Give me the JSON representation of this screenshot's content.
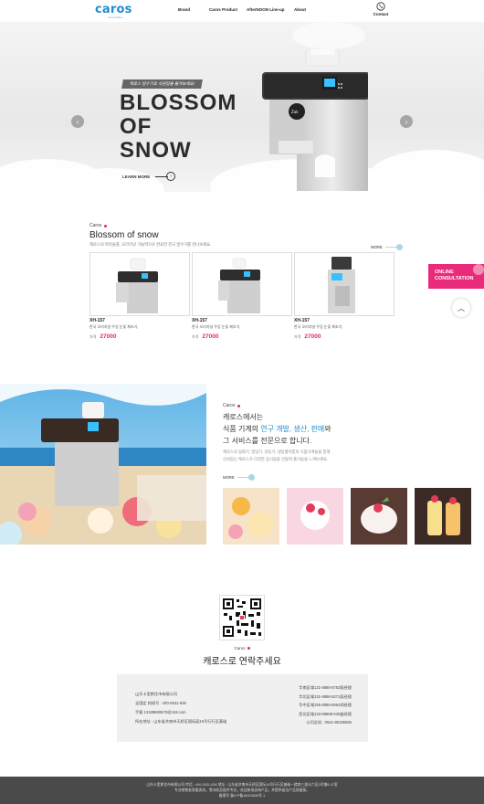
{
  "header": {
    "logo_text": "caros",
    "logo_sub": "Snow Maker",
    "nav": [
      "Brand",
      "Caros Product",
      "AfterNOON Line-up",
      "About"
    ],
    "contact_label": "Contact"
  },
  "hero": {
    "tag": "캐로스 빙수기로 식원함을 즐겨보세요!",
    "title_lines": [
      "BLOSSOM",
      "OF",
      "SNOW"
    ],
    "learn_more": "LEARN MORE",
    "prev_glyph": "‹",
    "next_glyph": "›"
  },
  "products": {
    "label": "Caros",
    "title": "Blossom of snow",
    "desc": "캐로스의 파라솔를, 오라지냥 기술력으로 완료한 한국 빙수기를 만나보세요.",
    "more": "MORE",
    "items": [
      {
        "name": "XH-157",
        "desc": "한국 오리지널 우잉 눈꽃 제조기,",
        "price_label": "가격",
        "price": "27000"
      },
      {
        "name": "XH-157",
        "desc": "한국 오리지널 우잉 눈꽃 제조기,",
        "price_label": "가격",
        "price": "27000"
      },
      {
        "name": "XH-157",
        "desc": "한국 오리지널 우잉 눈꽃 제조기,",
        "price_label": "가격",
        "price": "27000"
      }
    ]
  },
  "float": {
    "consult_line1": "ONLINE",
    "consult_line2": "CONSULTATION",
    "top_glyph": "︿"
  },
  "about": {
    "label": "Caros",
    "line1": "캐로스에서는",
    "line2_pre": "식품 기계의 ",
    "line2_hl": "연구 개발, 생산, 판매",
    "line2_post": "와",
    "line3": "그 서비스를 전문으로 합니다.",
    "desc1": "캐로스의 설화기, 얼빙기, 냉동기, 냉동혈어통의 식품기계들을 통해",
    "desc2": "신뢰있는 캐로스가 다양한 음식들을 만들며 즐거움을 느껴보세요.",
    "more": "MORE"
  },
  "contact": {
    "label": "Caros",
    "title": "캐로스로 연락주세요",
    "left_lines": [
      "山乐卡里斯住市有限公司",
      "全国定 热线号 : 400-0531-636",
      "手客 13188880570@163.com",
      "所在地址 : 山东省济南市天桥区国际园15号行行区基础"
    ],
    "right_lines": [
      "华南区域131-8888-5753段经理",
      "华北区域131-8888-5271段经理",
      "华中区域155-8888-6954郑经理",
      "西北区域133-88888-639盛经理",
      "公司总机 : 0531-89195555"
    ]
  },
  "footer": {
    "line1": "山东卡里斯住市有限公司 传话 : 400-0531-636 地址 : 山东省济南市天桥区国际15号行行区基础一楼南三部分六区3号铺6-37室",
    "line2": "专业销售各类贩卖机，雪冰机及配件专业，欢迎来电咨询产品，并提供省及产品质量保。",
    "line3": "备案号:鲁ICP备18043630号-1"
  },
  "colors": {
    "accent_pink": "#e8246f",
    "brand_blue": "#1c8fd1",
    "footer_bg": "#4a4a4a"
  }
}
